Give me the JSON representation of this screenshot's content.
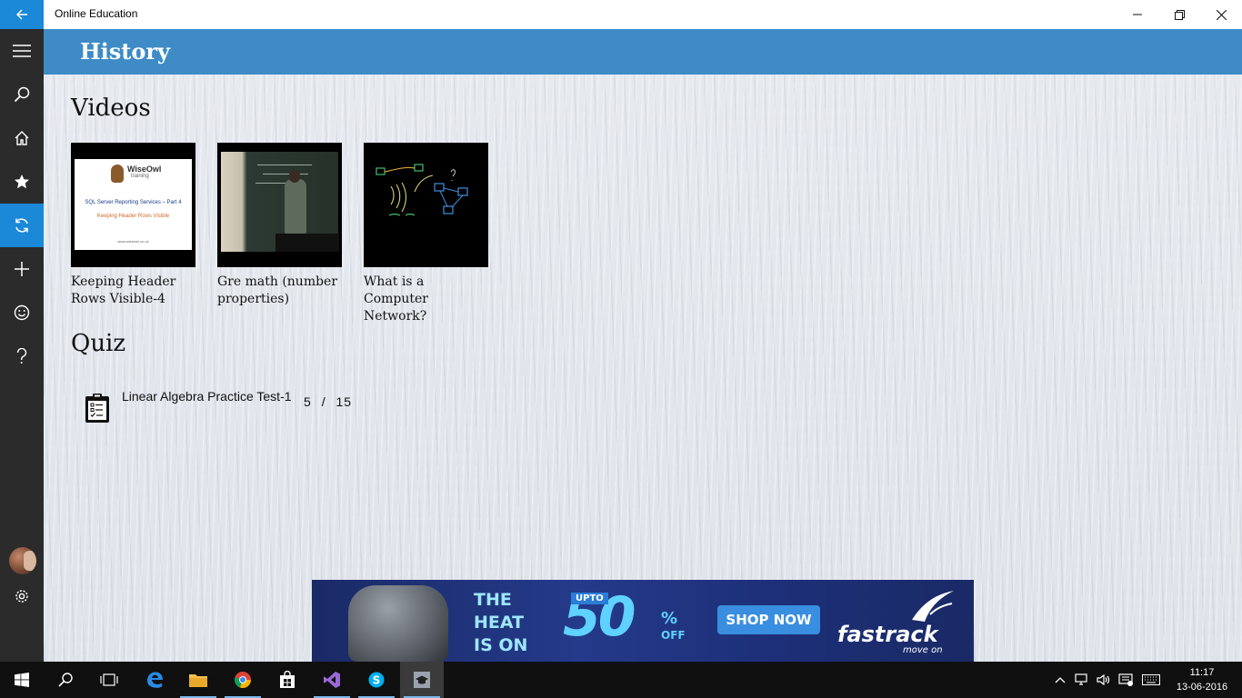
{
  "window": {
    "app_title": "Online Education",
    "back_icon": "back-arrow-icon",
    "minimize_label": "–",
    "restore_label": "❐",
    "close_label": "✕"
  },
  "nav": {
    "items": [
      {
        "name": "menu",
        "icon": "hamburger-icon"
      },
      {
        "name": "search",
        "icon": "search-icon"
      },
      {
        "name": "home",
        "icon": "home-icon"
      },
      {
        "name": "favorites",
        "icon": "star-icon"
      },
      {
        "name": "history",
        "icon": "refresh-icon",
        "active": true
      },
      {
        "name": "add",
        "icon": "plus-icon"
      },
      {
        "name": "feedback",
        "icon": "smiley-icon"
      },
      {
        "name": "help",
        "icon": "question-icon"
      },
      {
        "name": "settings",
        "icon": "gear-icon"
      }
    ]
  },
  "header": {
    "title": "History"
  },
  "videos": {
    "section_title": "Videos",
    "items": [
      {
        "caption": "Keeping Header Rows Visible-4",
        "thumb_brand": "WiseOwl",
        "thumb_brand_sub": "training",
        "thumb_title": "SQL Server Reporting Services – Part 4",
        "thumb_subtitle": "Keeping Header Rows Visible",
        "thumb_url": "www.wiseowl.co.uk"
      },
      {
        "caption": "Gre math (number properties)"
      },
      {
        "caption": "What is a Computer Network?"
      }
    ]
  },
  "quiz": {
    "section_title": "Quiz",
    "items": [
      {
        "name": "Linear Algebra Practice Test-1",
        "score": "5",
        "total": "15",
        "separator": "/"
      }
    ]
  },
  "ad": {
    "headline_line1": "THE",
    "headline_line2": "HEAT",
    "headline_line3": "IS ON",
    "upto": "UPTO",
    "percent": "50",
    "percent_sign": "%",
    "off": "OFF",
    "cta": "SHOP NOW",
    "brand": "fastrack",
    "tagline": "move on"
  },
  "taskbar": {
    "time": "11:17",
    "date": "13-06-2016",
    "apps": [
      {
        "name": "start",
        "icon": "windows-icon"
      },
      {
        "name": "search",
        "icon": "search-icon"
      },
      {
        "name": "task-view",
        "icon": "task-view-icon"
      },
      {
        "name": "edge",
        "icon": "edge-icon"
      },
      {
        "name": "file-explorer",
        "icon": "folder-icon"
      },
      {
        "name": "chrome",
        "icon": "chrome-icon"
      },
      {
        "name": "store",
        "icon": "store-icon"
      },
      {
        "name": "visual-studio",
        "icon": "visual-studio-icon"
      },
      {
        "name": "skype",
        "icon": "skype-icon"
      },
      {
        "name": "online-education",
        "icon": "graduation-cap-icon"
      }
    ]
  },
  "colors": {
    "accent": "#1b88d8",
    "header_blue": "#3e8bc6",
    "nav_dark": "#2b2b2b",
    "taskbar": "#101010"
  }
}
